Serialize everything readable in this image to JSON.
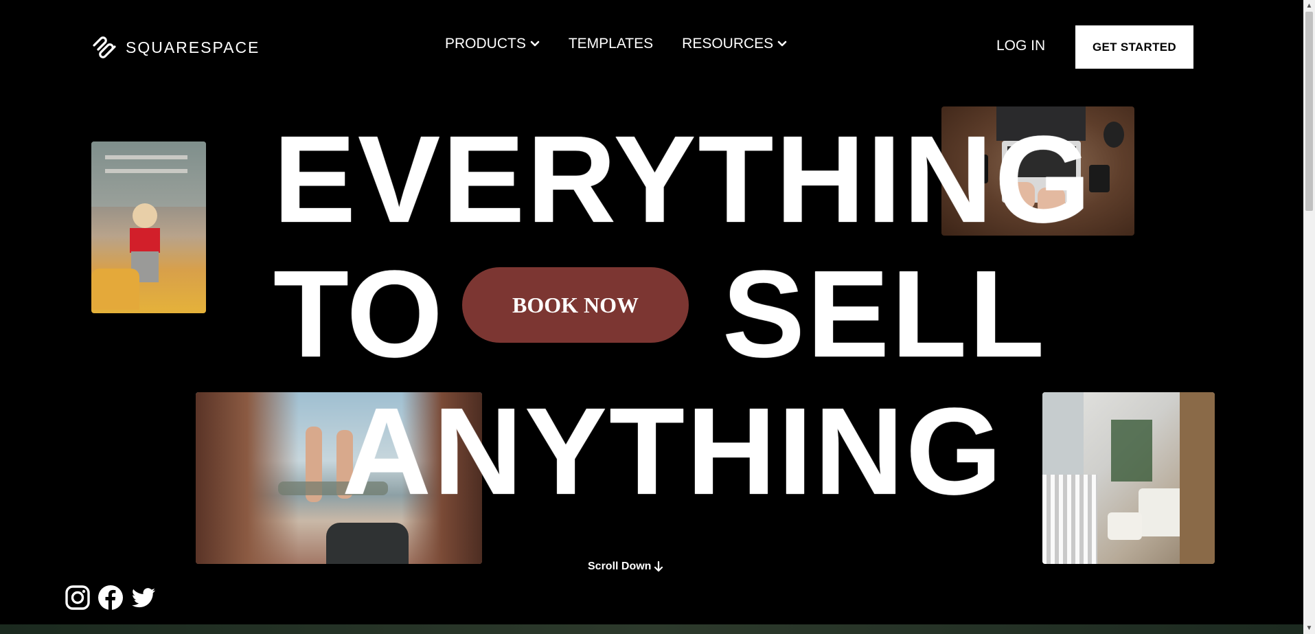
{
  "brand": {
    "name": "SQUARESPACE",
    "logo_icon": "squarespace-logo-icon"
  },
  "nav": {
    "items": [
      {
        "label": "PRODUCTS",
        "has_dropdown": true
      },
      {
        "label": "TEMPLATES",
        "has_dropdown": false
      },
      {
        "label": "RESOURCES",
        "has_dropdown": true
      }
    ],
    "login_label": "LOG IN",
    "cta_label": "GET STARTED"
  },
  "hero": {
    "line1": "EVERYTHING",
    "line2a": "TO",
    "line2b": "SELL",
    "line3": "ANYTHING",
    "book_label": "BOOK NOW",
    "scroll_label": "Scroll Down",
    "scroll_icon": "arrow-down-icon"
  },
  "social": {
    "icons": [
      "instagram-icon",
      "facebook-icon",
      "twitter-icon"
    ]
  },
  "colors": {
    "background": "#000000",
    "accent_button": "#7c3632",
    "cta_background": "#ffffff",
    "text": "#ffffff"
  }
}
